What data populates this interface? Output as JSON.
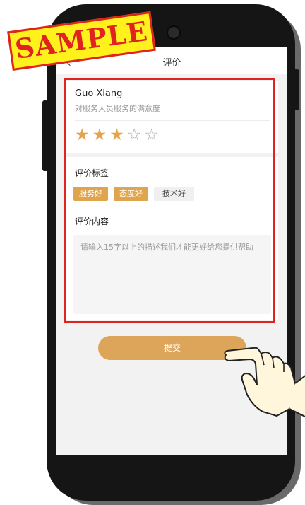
{
  "watermark": "SAMPLE",
  "nav": {
    "title": "评价",
    "back_icon": "chevron-left-icon"
  },
  "rating_card": {
    "name": "Guo Xiang",
    "subtitle": "对服务人员服务的满意度",
    "rating": 3,
    "max_rating": 5,
    "star_filled": "★",
    "star_empty": "☆"
  },
  "tags_section": {
    "label": "评价标签",
    "tags": [
      {
        "label": "服务好",
        "selected": true
      },
      {
        "label": "态度好",
        "selected": true
      },
      {
        "label": "技术好",
        "selected": false
      }
    ]
  },
  "content_section": {
    "label": "评价内容",
    "placeholder": "请输入15字以上的描述我们才能更好给您提供帮助"
  },
  "submit_label": "提交",
  "colors": {
    "accent": "#dea54e",
    "highlight": "#e0231f",
    "sample_bg": "#fff21c"
  }
}
